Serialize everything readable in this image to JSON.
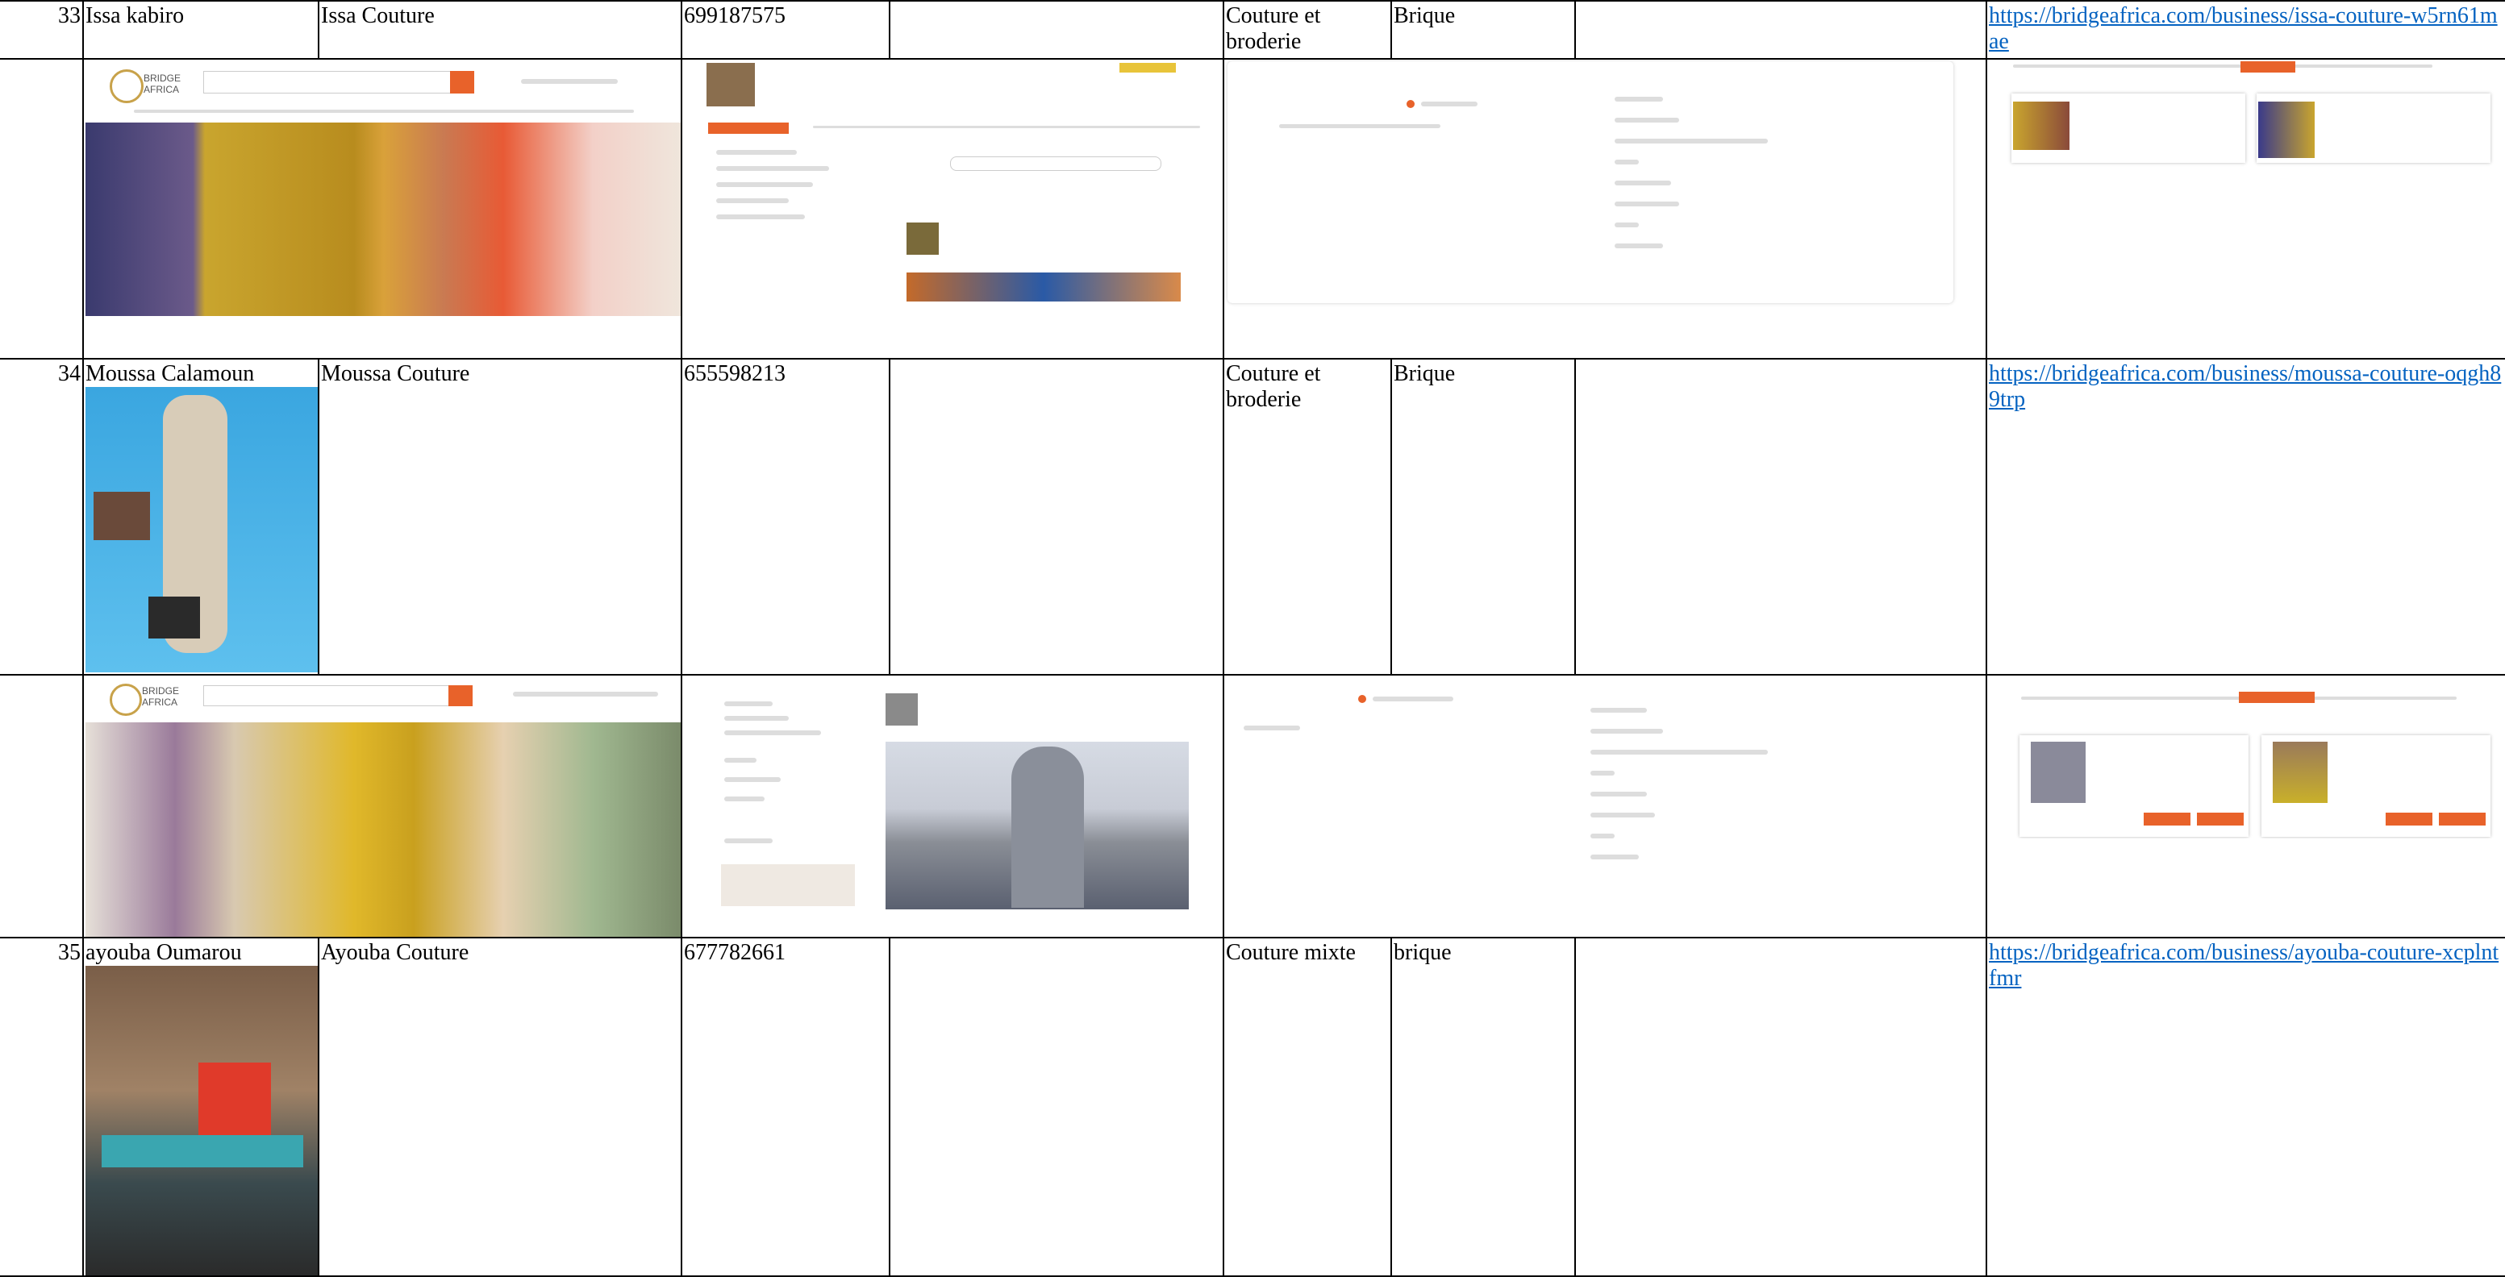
{
  "rows": [
    {
      "number": "33",
      "owner": "Issa kabiro",
      "business": "Issa Couture",
      "phone": "699187575",
      "category": "Couture et broderie",
      "location": "Brique",
      "url": "https://bridgeafrica.com/business/issa-couture-w5rn61mae"
    },
    {
      "number": "34",
      "owner": "Moussa Calamoun",
      "business": "Moussa Couture",
      "phone": "655598213",
      "category": "Couture et broderie",
      "location": "Brique",
      "url": "https://bridgeafrica.com/business/moussa-couture-oqgh89trp"
    },
    {
      "number": "35",
      "owner": "ayouba Oumarou",
      "business": "Ayouba Couture",
      "phone": "677782661",
      "category": "Couture mixte",
      "location": "brique",
      "url": "https://bridgeafrica.com/business/ayouba-couture-xcplntfmr"
    }
  ],
  "colors": {
    "brand_orange": "#e8622a",
    "link_blue": "#0563c1"
  }
}
